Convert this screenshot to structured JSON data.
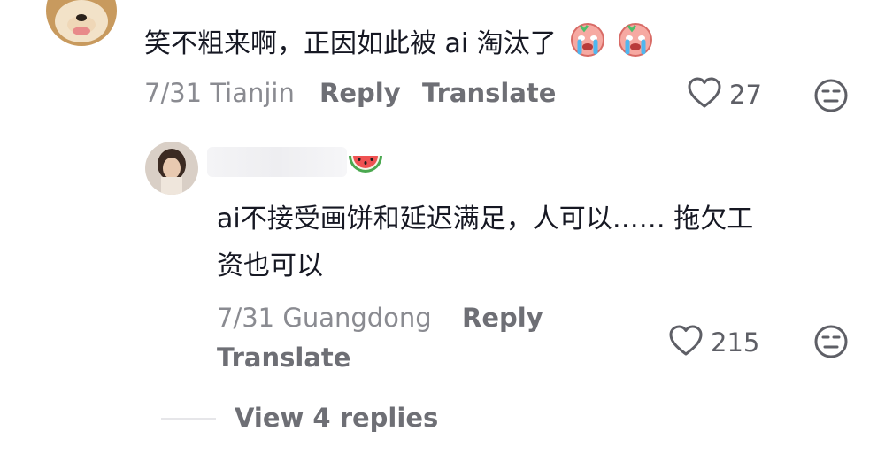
{
  "comments": [
    {
      "text": "笑不粗来啊，正因如此被 ai 淘汰了",
      "emoji": [
        "crying-emoji",
        "crying-emoji"
      ],
      "date_location": "7/31 Tianjin",
      "reply_label": "Reply",
      "translate_label": "Translate",
      "likes": "27"
    },
    {
      "name_emoji": "watermelon-emoji",
      "text_line1": "ai不接受画饼和延迟满足，人可以…… 拖欠工",
      "text_line2": "资也可以",
      "date_location": "7/31 Guangdong",
      "reply_label": "Reply",
      "translate_label": "Translate",
      "likes": "215"
    }
  ],
  "view_replies_label": "View 4 replies",
  "colors": {
    "text": "#161823",
    "meta": "#8a8b91",
    "icon": "#5e5f66"
  }
}
